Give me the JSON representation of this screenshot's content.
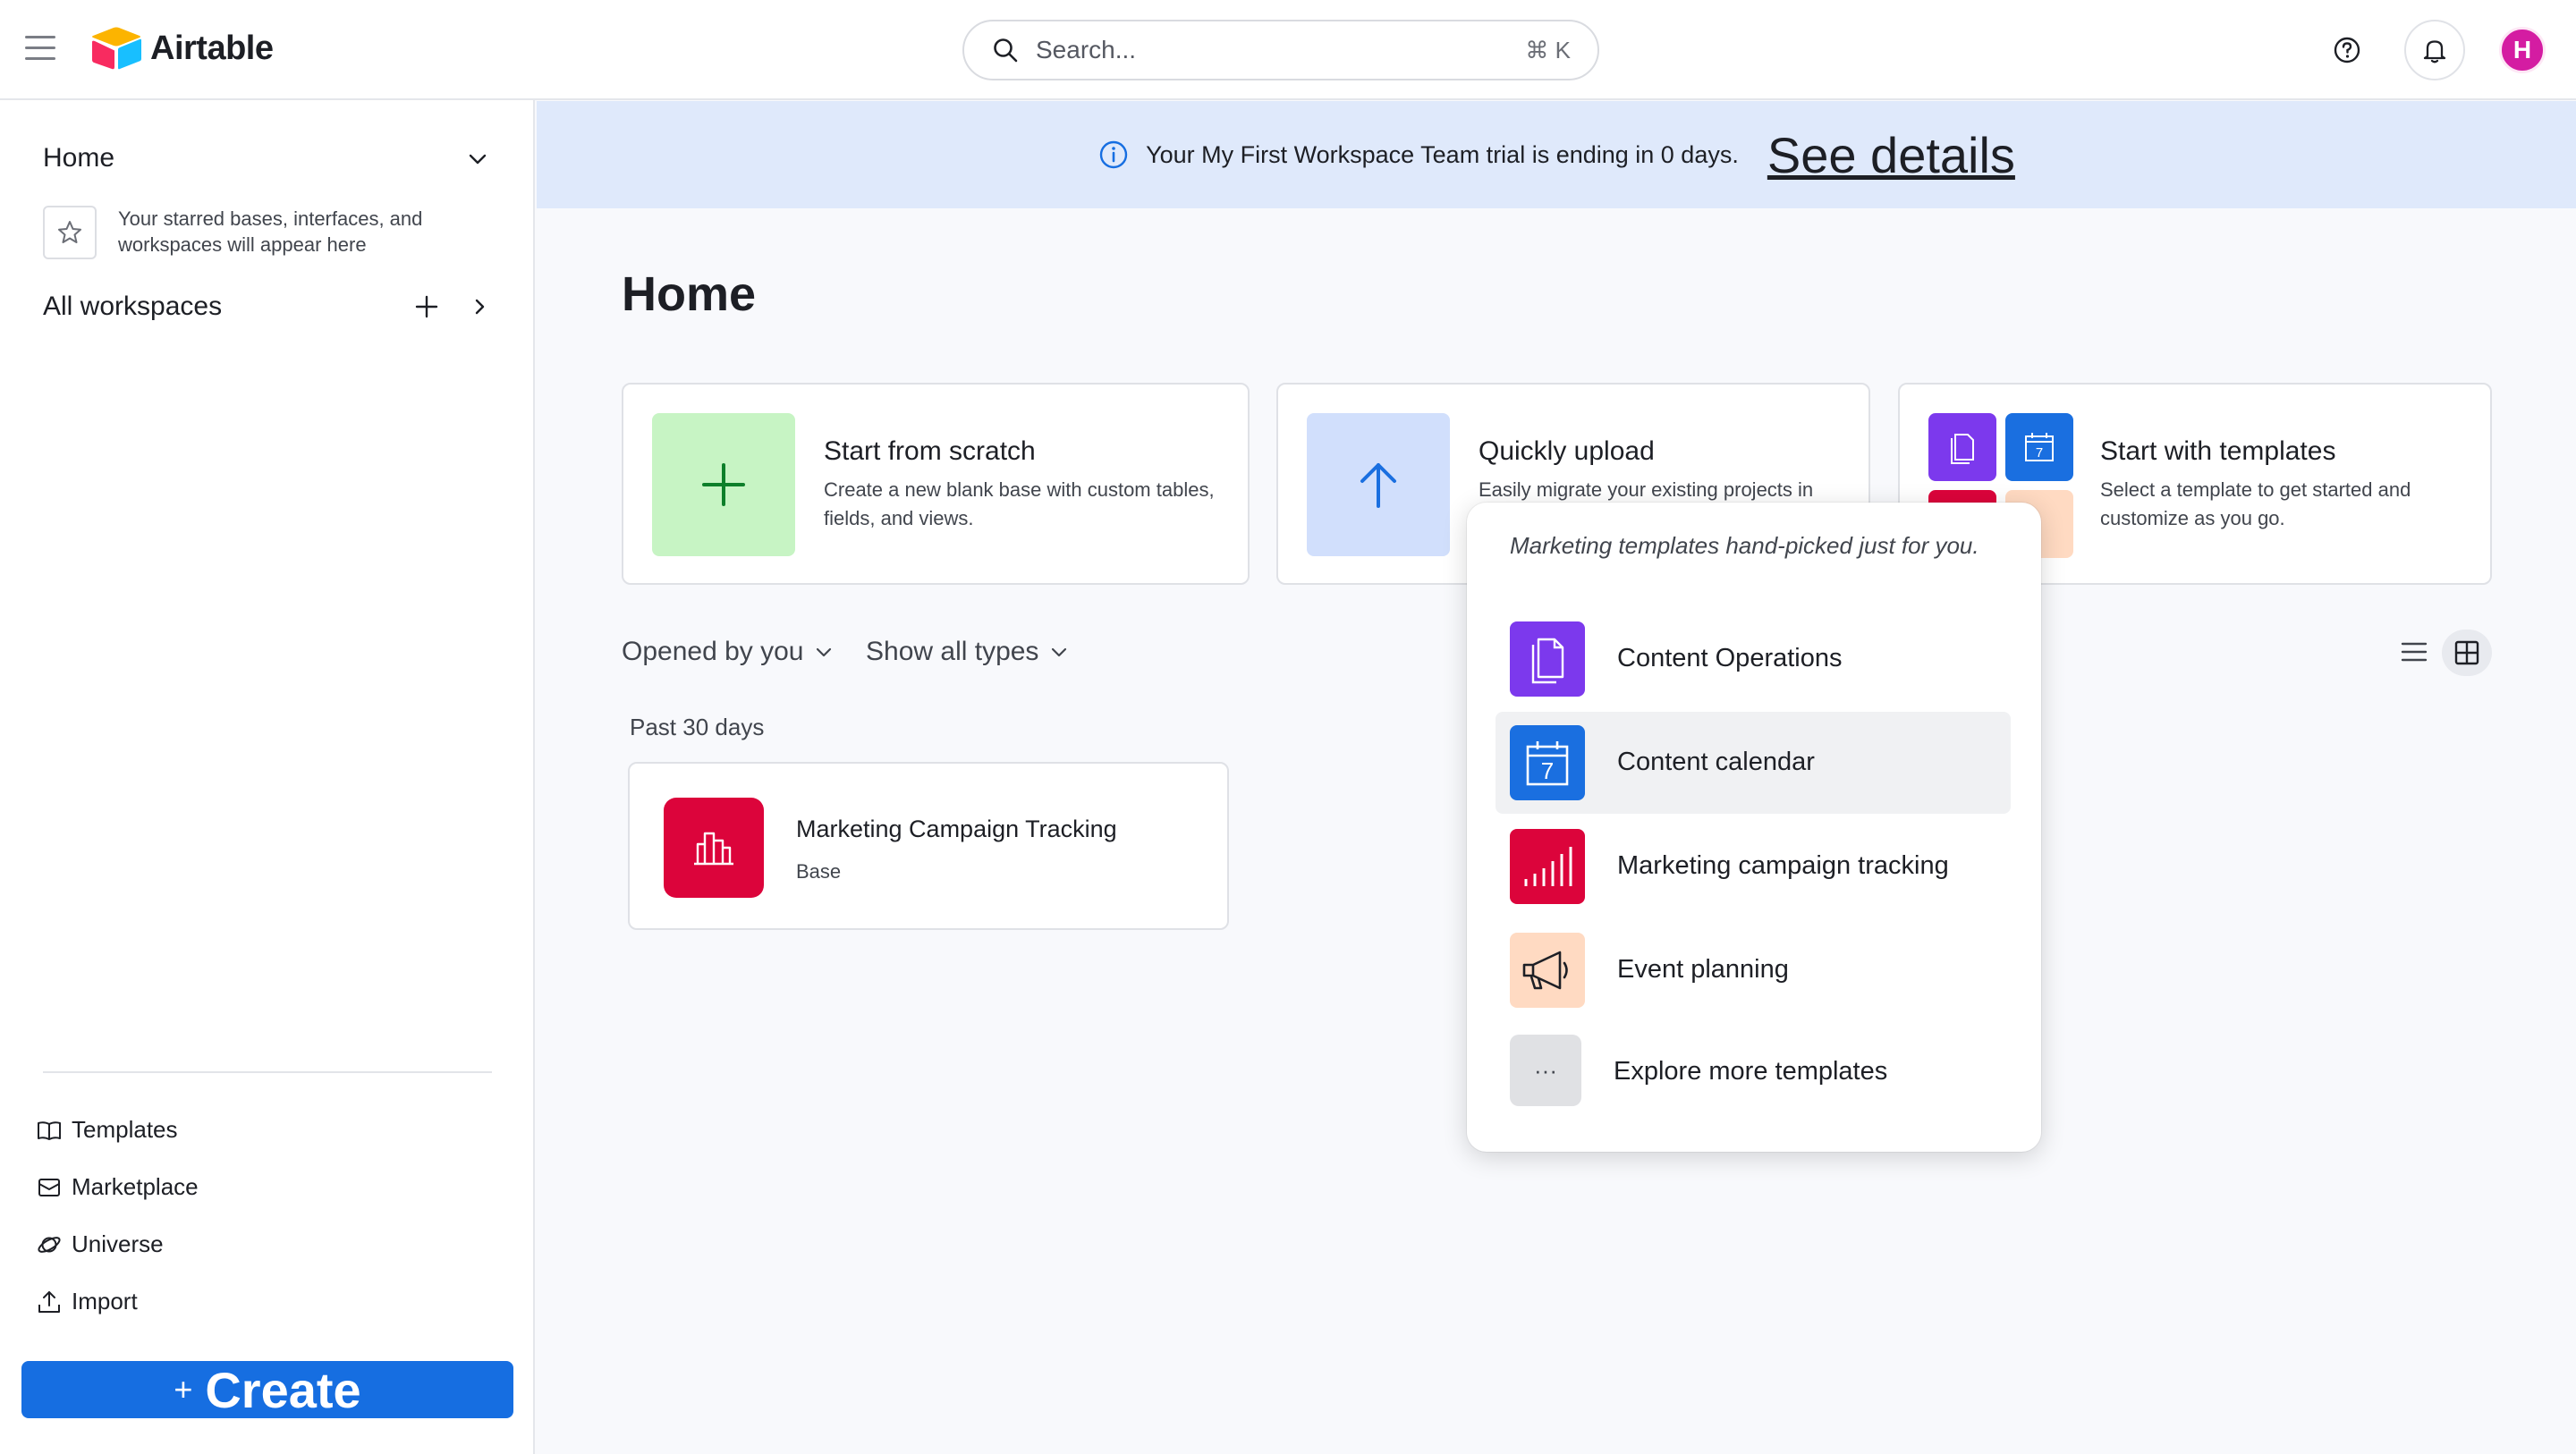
{
  "app": {
    "name": "Airtable"
  },
  "search": {
    "placeholder": "Search...",
    "shortcut": "⌘ K"
  },
  "user": {
    "initial": "H",
    "avatar_color": "#d41ca2"
  },
  "sidebar": {
    "home_label": "Home",
    "starred_hint": "Your starred bases, interfaces, and workspaces will appear here",
    "workspaces_label": "All workspaces",
    "links": [
      {
        "label": "Templates",
        "icon": "book-icon"
      },
      {
        "label": "Marketplace",
        "icon": "marketplace-icon"
      },
      {
        "label": "Universe",
        "icon": "universe-icon"
      },
      {
        "label": "Import",
        "icon": "upload-icon"
      }
    ],
    "create_label": "Create"
  },
  "banner": {
    "text": "Your My First Workspace Team trial is ending in 0 days.",
    "link": "See details"
  },
  "main": {
    "title": "Home",
    "cards": [
      {
        "title": "Start from scratch",
        "desc": "Create a new blank base with custom tables, fields, and views."
      },
      {
        "title": "Quickly upload",
        "desc": "Easily migrate your existing projects in"
      },
      {
        "title": "Start with templates",
        "desc": "Select a template to get started and customize as you go."
      }
    ],
    "filters": {
      "opened": "Opened by you",
      "types": "Show all types"
    },
    "section_label": "Past 30 days",
    "recent": [
      {
        "name": "Marketing Campaign Tracking",
        "type": "Base"
      }
    ]
  },
  "popover": {
    "hint": "Marketing templates hand-picked just for you.",
    "items": [
      {
        "label": "Content Operations",
        "icon": "document-icon",
        "color": "#7c39ed"
      },
      {
        "label": "Content calendar",
        "icon": "calendar-icon",
        "color": "#1a6fe0"
      },
      {
        "label": "Marketing campaign tracking",
        "icon": "bar-chart-icon",
        "color": "#dc043b"
      },
      {
        "label": "Event planning",
        "icon": "megaphone-icon",
        "color": "#ffdac2"
      },
      {
        "label": "Explore more templates",
        "icon": "more-icon",
        "color": "#e0e1e4"
      }
    ]
  },
  "colors": {
    "accent": "#166ee1",
    "banner_bg": "#dfe9fb",
    "scratch_tile": "#c7f4c4",
    "upload_tile": "#d1dffc"
  }
}
